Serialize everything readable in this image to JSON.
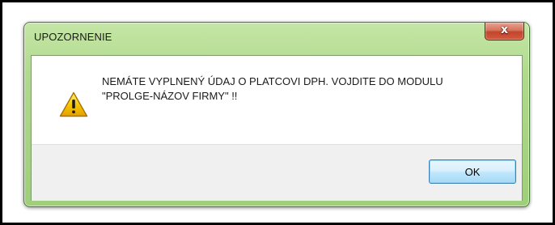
{
  "dialog": {
    "title": "UPOZORNENIE",
    "close_glyph": "x",
    "icon": "warning-icon",
    "message_line_1": "NEMÁTE VYPLNENÝ ÚDAJ O PLATCOVI DPH. VOJDITE DO MODULU",
    "message_line_2": "\"PROLGE-NÁZOV FIRMY\" !!",
    "ok_label": "OK"
  },
  "colors": {
    "frame_accent": "#afd98c",
    "close_button": "#c2452c",
    "ok_button_border": "#3c7fb1",
    "button_area_bg": "#f0f0f0",
    "warning_fill": "#f5c400"
  }
}
